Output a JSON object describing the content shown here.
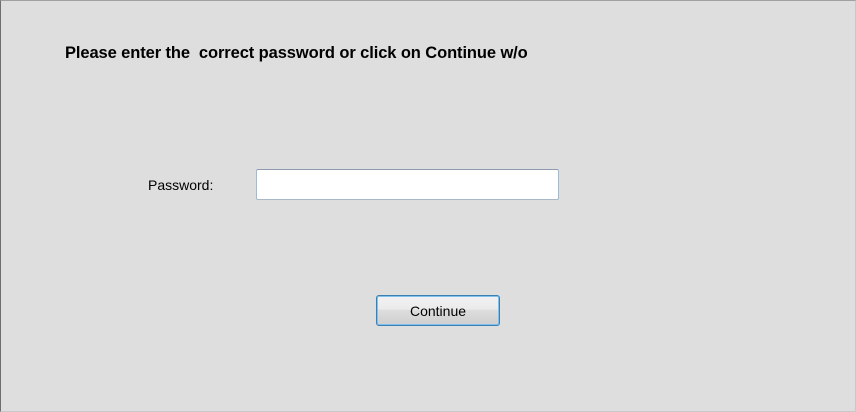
{
  "dialog": {
    "prompt": "Please enter the  correct password or click on Continue w/o",
    "password_label": "Password:",
    "password_value": "",
    "password_placeholder": "",
    "continue_label": "Continue"
  }
}
